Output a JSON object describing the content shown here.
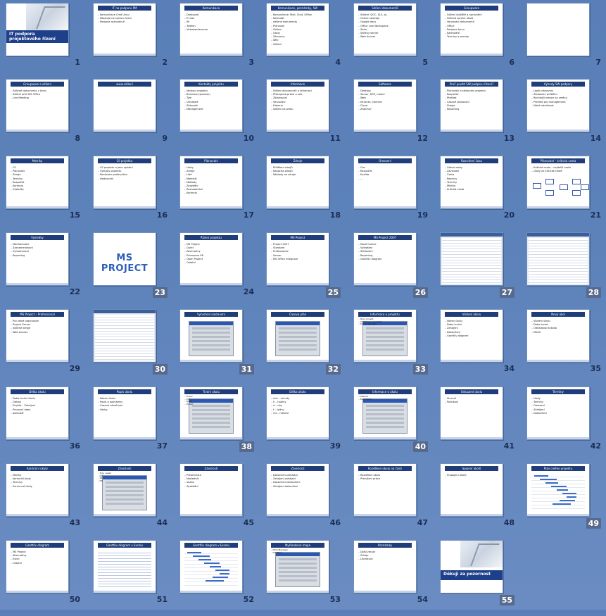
{
  "slides": [
    {
      "n": "1",
      "kind": "title",
      "title": "IT podpora projektového řízení",
      "lines": []
    },
    {
      "n": "2",
      "title": "IT na podporu PM",
      "lines": [
        "Komunikace Cmd Ulrou",
        "Nástroje na správu řízení",
        "Podpora rozhodnutí"
      ]
    },
    {
      "n": "3",
      "title": "Komunikace",
      "lines": [
        "Dostupné",
        "E-mail",
        "IM",
        "Telefon",
        "Videokonference"
      ]
    },
    {
      "n": "4",
      "title": "Komunikace, poznámky, SW",
      "lines": [
        "Komunikace: Mail, Chat, Office",
        "Kalendář",
        "sdílené dokumenty",
        "Plánovač",
        "Sdílení",
        "Úkoly",
        "Záznamy",
        "Wiki",
        "Sdílení"
      ]
    },
    {
      "n": "5",
      "title": "Sdílení dokumentů",
      "lines": [
        "Sdílení: DOC, XLS, aj.",
        "Online nástroje",
        "Google docs",
        "Office Live Workspace",
        "Zoho",
        "Sdílený server",
        "Web Access"
      ]
    },
    {
      "n": "6",
      "title": "Groupware",
      "lines": [
        "Sdílení úložiště a oprávnění",
        "Sdílená správa úkolů",
        "Verzování dokumentů",
        "Office",
        "Podpora týmu",
        "Kalendáře",
        "Termíny a porady"
      ]
    },
    {
      "n": "7",
      "kind": "blank",
      "title": "",
      "lines": []
    },
    {
      "n": "8",
      "title": "Groupware a sdílení",
      "lines": [
        "Sdílené dokumenty v týmu",
        "Sdílení přes MS Office",
        "Live Meeting"
      ]
    },
    {
      "n": "9",
      "title": "www.sdílení",
      "lines": []
    },
    {
      "n": "10",
      "title": "Kontakty projektu",
      "lines": [
        "Vedoucí projektu",
        "Business (sponzor)",
        "Tým",
        "Uživatelé",
        "Zákazník",
        "Management"
      ]
    },
    {
      "n": "11",
      "title": "Informace",
      "lines": [
        "Sdílení dokumentů a informací",
        "Přístupová práva a role",
        "Zálohování",
        "Verzování",
        "Historie",
        "Sdílení na webu"
      ]
    },
    {
      "n": "12",
      "title": "Software",
      "lines": [
        "Desktop",
        "Server, ERP, modul",
        "Web",
        "Intranet, internet",
        "Cloud",
        "Zdarma?"
      ]
    },
    {
      "n": "13",
      "title": "Proč použít SW podporu řízení?",
      "lines": [
        "Plánování a sledování projektu",
        "Rozpočet",
        "Přehled",
        "Časové plánování",
        "Zdroje",
        "Reporting"
      ]
    },
    {
      "n": "14",
      "title": "Výhody SW podpory",
      "lines": [
        "Lepší plánování",
        "Sledování průběhu",
        "Rychlejší reakce na změny",
        "Přehled pro management",
        "Nízká náročnost"
      ]
    },
    {
      "n": "15",
      "title": "Metriky",
      "lines": [
        "Cíl",
        "Plánování",
        "Zdroje",
        "Termíny",
        "Rozpočet",
        "Kontrola",
        "Výsledky"
      ]
    },
    {
      "n": "16",
      "title": "Cíl projektu",
      "lines": [
        "Cíl projektu a jeho splnění",
        "Výstupy projektu",
        "Realizace podle plánu",
        "Hodnocení"
      ]
    },
    {
      "n": "17",
      "title": "Plánování",
      "lines": [
        "Úkoly",
        "Zdroje",
        "Lidé",
        "Materiál",
        "Náklady",
        "Zpoždění",
        "Rozhodování",
        "Kontrola"
      ]
    },
    {
      "n": "18",
      "title": "Zdroje",
      "lines": [
        "Přidělení zdrojů",
        "Kapacita zdrojů",
        "Náklady na zdroje"
      ]
    },
    {
      "n": "19",
      "title": "Omezení",
      "lines": [
        "Čas",
        "Rozpočet",
        "Kvalita",
        "…"
      ]
    },
    {
      "n": "20",
      "title": "Rozvržení času",
      "lines": [
        "Odhad doby",
        "Závislosti",
        "Cesta",
        "Rezervy",
        "Termíny",
        "Milníky",
        "Kritická cesta"
      ]
    },
    {
      "n": "21",
      "kind": "network",
      "title": "Plánování – kritická cesta",
      "lines": [
        "Kritická cesta – nejdelší cesta",
        "Úkoly na kritické cestě"
      ]
    },
    {
      "n": "22",
      "title": "Výsledky",
      "lines": [
        "Monitorování",
        "Zaznamenávání",
        "Vyhodnocení",
        "Reporting"
      ]
    },
    {
      "n": "23",
      "kind": "big",
      "title": "MS PROJECT",
      "lines": []
    },
    {
      "n": "24",
      "title": "Řízení projektu",
      "lines": [
        "MS Project",
        "Gantt",
        "Alternativy",
        "Primavera P6",
        "Open Project",
        "Ostatní"
      ]
    },
    {
      "n": "25",
      "title": "MS Project",
      "lines": [
        "Project 2007",
        "Standard",
        "Professional",
        "Server",
        "MS Office integrace"
      ]
    },
    {
      "n": "26",
      "title": "MS Project 2007",
      "lines": [
        "Nové funkce",
        "Vylepšení",
        "Sledování",
        "Reporting",
        "Ganttův diagram"
      ]
    },
    {
      "n": "27",
      "kind": "sheet",
      "title": "",
      "lines": []
    },
    {
      "n": "28",
      "kind": "sheet",
      "title": "",
      "lines": []
    },
    {
      "n": "29",
      "title": "MS Project – Professional",
      "lines": [
        "Pro velké organizace",
        "Project Server",
        "Sdílené zdroje",
        "Web Access"
      ]
    },
    {
      "n": "30",
      "kind": "sheet",
      "title": "",
      "lines": []
    },
    {
      "n": "31",
      "kind": "dialog",
      "title": "Vytvoření nastavení",
      "lines": []
    },
    {
      "n": "32",
      "kind": "dialog",
      "title": "Časový plán",
      "lines": []
    },
    {
      "n": "33",
      "kind": "dialog",
      "title": "Informace o projektu",
      "lines": [
        "Nový projekt",
        "Informace o projektu",
        "Datum zahájení"
      ]
    },
    {
      "n": "34",
      "title": "Vložení úkolu",
      "lines": [
        "Název úkolu",
        "Doba trvání",
        "Zahájení",
        "Dokončení",
        "Ganttův diagram"
      ]
    },
    {
      "n": "35",
      "title": "Nový úkol",
      "lines": [
        "Vložení úkolu",
        "Doba trvání",
        "Odhadovaná doba",
        "Milník"
      ]
    },
    {
      "n": "36",
      "title": "Délka úkolu",
      "lines": [
        "Doba trvání úkolu",
        "Odhad",
        "Projekt – Zahájení",
        "Pracovní doba",
        "Kalendář"
      ]
    },
    {
      "n": "37",
      "title": "Popis úkolu",
      "lines": [
        "Název úkolu",
        "Popis a poznámky",
        "Časová náročnost",
        "Vazby"
      ]
    },
    {
      "n": "38",
      "kind": "dialog",
      "title": "Trvání úkolu",
      "lines": [
        "Trvání",
        "Dny",
        "Týdny",
        "Odhad"
      ]
    },
    {
      "n": "39",
      "title": "Délka úkolu",
      "lines": [
        "min – minuty",
        "h – hodiny",
        "d – dny",
        "t – týdny",
        "ms – měsíce"
      ]
    },
    {
      "n": "40",
      "kind": "dialog",
      "title": "Informace o úkolu",
      "lines": [
        "Obecné",
        "Předchůdci"
      ]
    },
    {
      "n": "41",
      "title": "Odsazení úkolu",
      "lines": [
        "Shrnutí",
        "Podúkoly"
      ]
    },
    {
      "n": "42",
      "title": "Termíny",
      "lines": [
        "Úkoly",
        "Termíny",
        "Omezení",
        "Zahájení",
        "Dokončení"
      ]
    },
    {
      "n": "43",
      "title": "Kontrolní úkoly",
      "lines": [
        "Milníky",
        "Kontrolní body",
        "Termíny",
        "Souhrnné úkoly"
      ]
    },
    {
      "n": "44",
      "kind": "dialog",
      "title": "Závislosti",
      "lines": [
        "Typy vazeb",
        "DZ",
        "ZZ",
        "DD"
      ]
    },
    {
      "n": "45",
      "title": "Závislosti",
      "lines": [
        "Předchůdce",
        "Následník",
        "Vazba",
        "Zpoždění"
      ]
    },
    {
      "n": "46",
      "title": "Závislosti",
      "lines": [
        "Dokončení-zahájení",
        "Zahájení-zahájení",
        "Dokončení-dokončení",
        "Zahájení-dokončení"
      ]
    },
    {
      "n": "47",
      "title": "Rozdělení úkolu na části",
      "lines": [
        "Rozdělení úkolu",
        "Přerušení práce"
      ]
    },
    {
      "n": "48",
      "title": "Spojení úkolů",
      "lines": [
        "Propojení úkolů"
      ]
    },
    {
      "n": "49",
      "kind": "gantt",
      "title": "Plán celého projektu",
      "lines": []
    },
    {
      "n": "50",
      "title": "Ganttův diagram",
      "lines": [
        "MS Project",
        "Alternativy",
        "Excel",
        "Ostatní"
      ]
    },
    {
      "n": "51",
      "kind": "table",
      "title": "Ganttův diagram v Excelu",
      "lines": []
    },
    {
      "n": "52",
      "kind": "gantt",
      "title": "Ganttův diagram v Excelu",
      "lines": []
    },
    {
      "n": "53",
      "kind": "dialog",
      "title": "Myšlenková mapa",
      "lines": [
        "Mind Manager",
        "FreeMind"
      ]
    },
    {
      "n": "54",
      "title": "Poznámky",
      "lines": [
        "Další zdroje",
        "Zdroje",
        "Literatura"
      ]
    },
    {
      "n": "55",
      "kind": "end",
      "title": "Děkuji za pozornost",
      "lines": []
    }
  ]
}
